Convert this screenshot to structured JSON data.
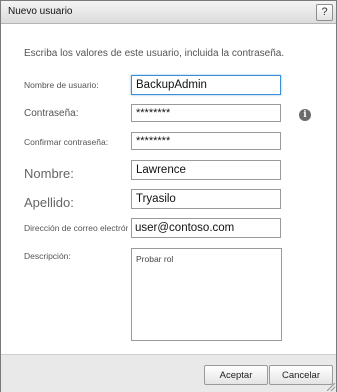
{
  "dialog": {
    "title": "Nuevo usuario",
    "help_glyph": "?"
  },
  "instructions": "Escriba los valores de este usuario, incluida la contraseña.",
  "fields": {
    "username": {
      "label": "Nombre de usuario:",
      "value": "BackupAdmin"
    },
    "password": {
      "label": "Contraseña:",
      "value": "********"
    },
    "confirm_password": {
      "label": "Confirmar contraseña:",
      "value": "********"
    },
    "first_name": {
      "label": "Nombre:",
      "value": "Lawrence"
    },
    "last_name": {
      "label": "Apellido:",
      "value": "Tryasilo"
    },
    "email": {
      "label": "Dirección de correo electrónico:",
      "value": "user@contoso.com"
    },
    "description": {
      "label": "Descripción:",
      "value": "Probar rol"
    }
  },
  "info_icon_glyph": "i",
  "buttons": {
    "accept": "Aceptar",
    "cancel": "Cancelar"
  }
}
